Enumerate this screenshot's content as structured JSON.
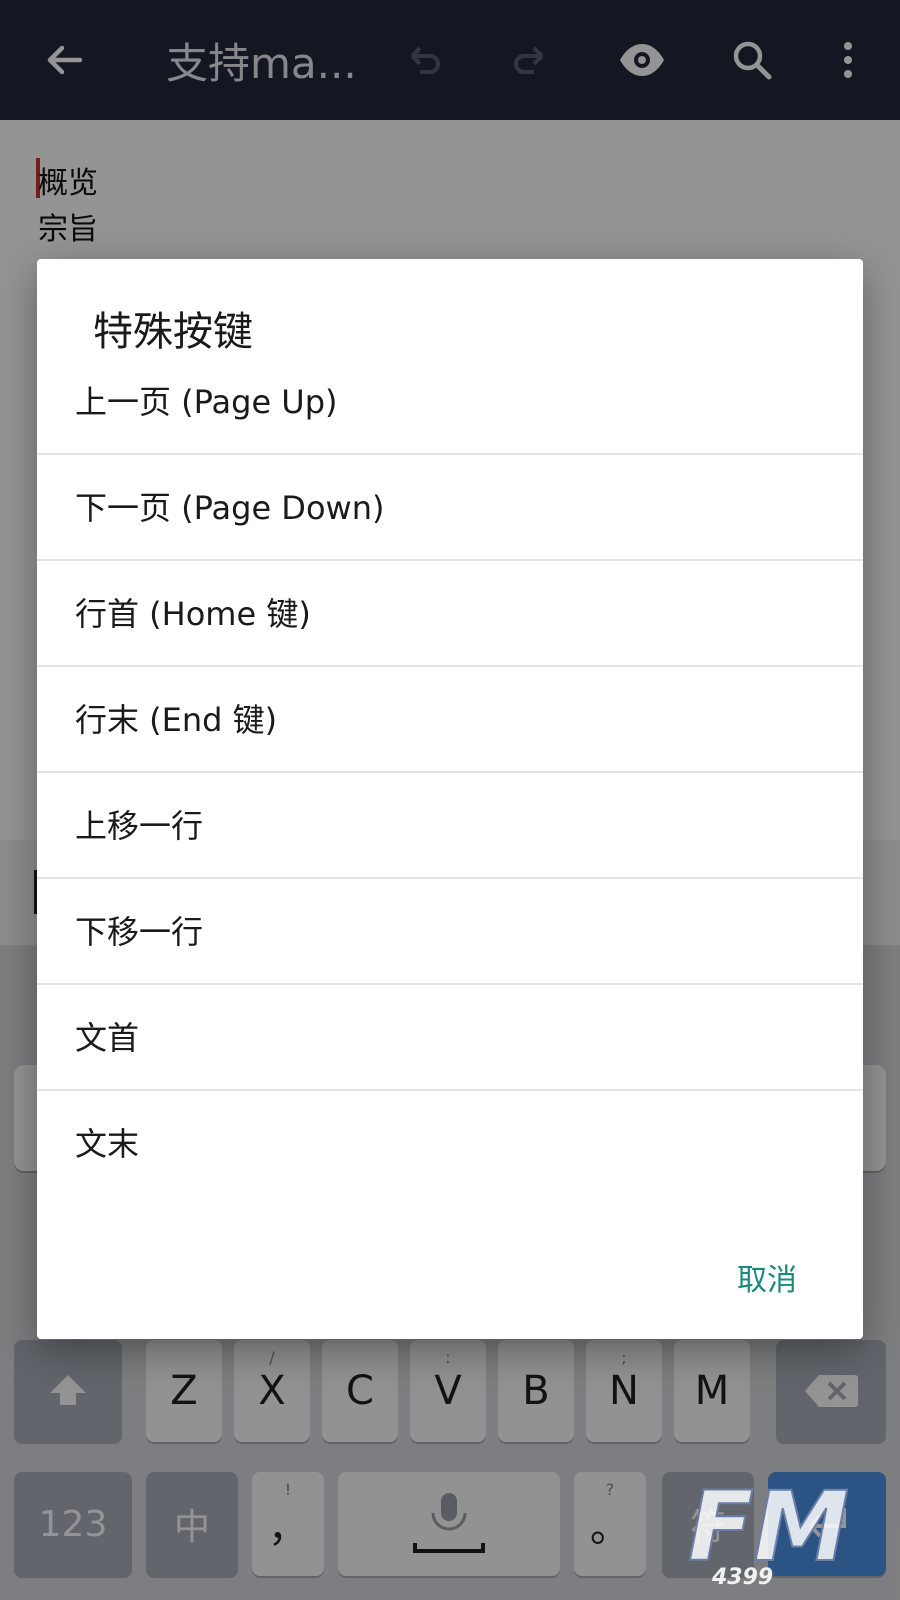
{
  "appbar": {
    "title": "支持ma...",
    "icons": [
      "back-arrow-icon",
      "undo-icon",
      "redo-icon",
      "eye-icon",
      "search-icon",
      "more-vert-icon"
    ]
  },
  "editor": {
    "lines": [
      "概览",
      "宗旨"
    ]
  },
  "dialog": {
    "title": "特殊按键",
    "options": [
      "上一页 (Page Up)",
      "下一页 (Page Down)",
      "行首 (Home 键)",
      "行末 (End 键)",
      "上移一行",
      "下移一行",
      "文首",
      "文末"
    ],
    "cancel_label": "取消",
    "accent_color": "#1a8a7c"
  },
  "keyboard": {
    "row3": [
      "Z",
      "X",
      "C",
      "V",
      "B",
      "N",
      "M"
    ],
    "row3_hints": [
      "",
      "/",
      "",
      ":",
      "",
      ";",
      ""
    ],
    "row4": {
      "num_label": "123",
      "lang_label": "中",
      "comma_label": "，",
      "comma_hint": "!",
      "period_label": "。",
      "period_hint": "?",
      "symbol_label": "符"
    }
  },
  "watermark": {
    "brand": "FM",
    "sub": "4399"
  }
}
